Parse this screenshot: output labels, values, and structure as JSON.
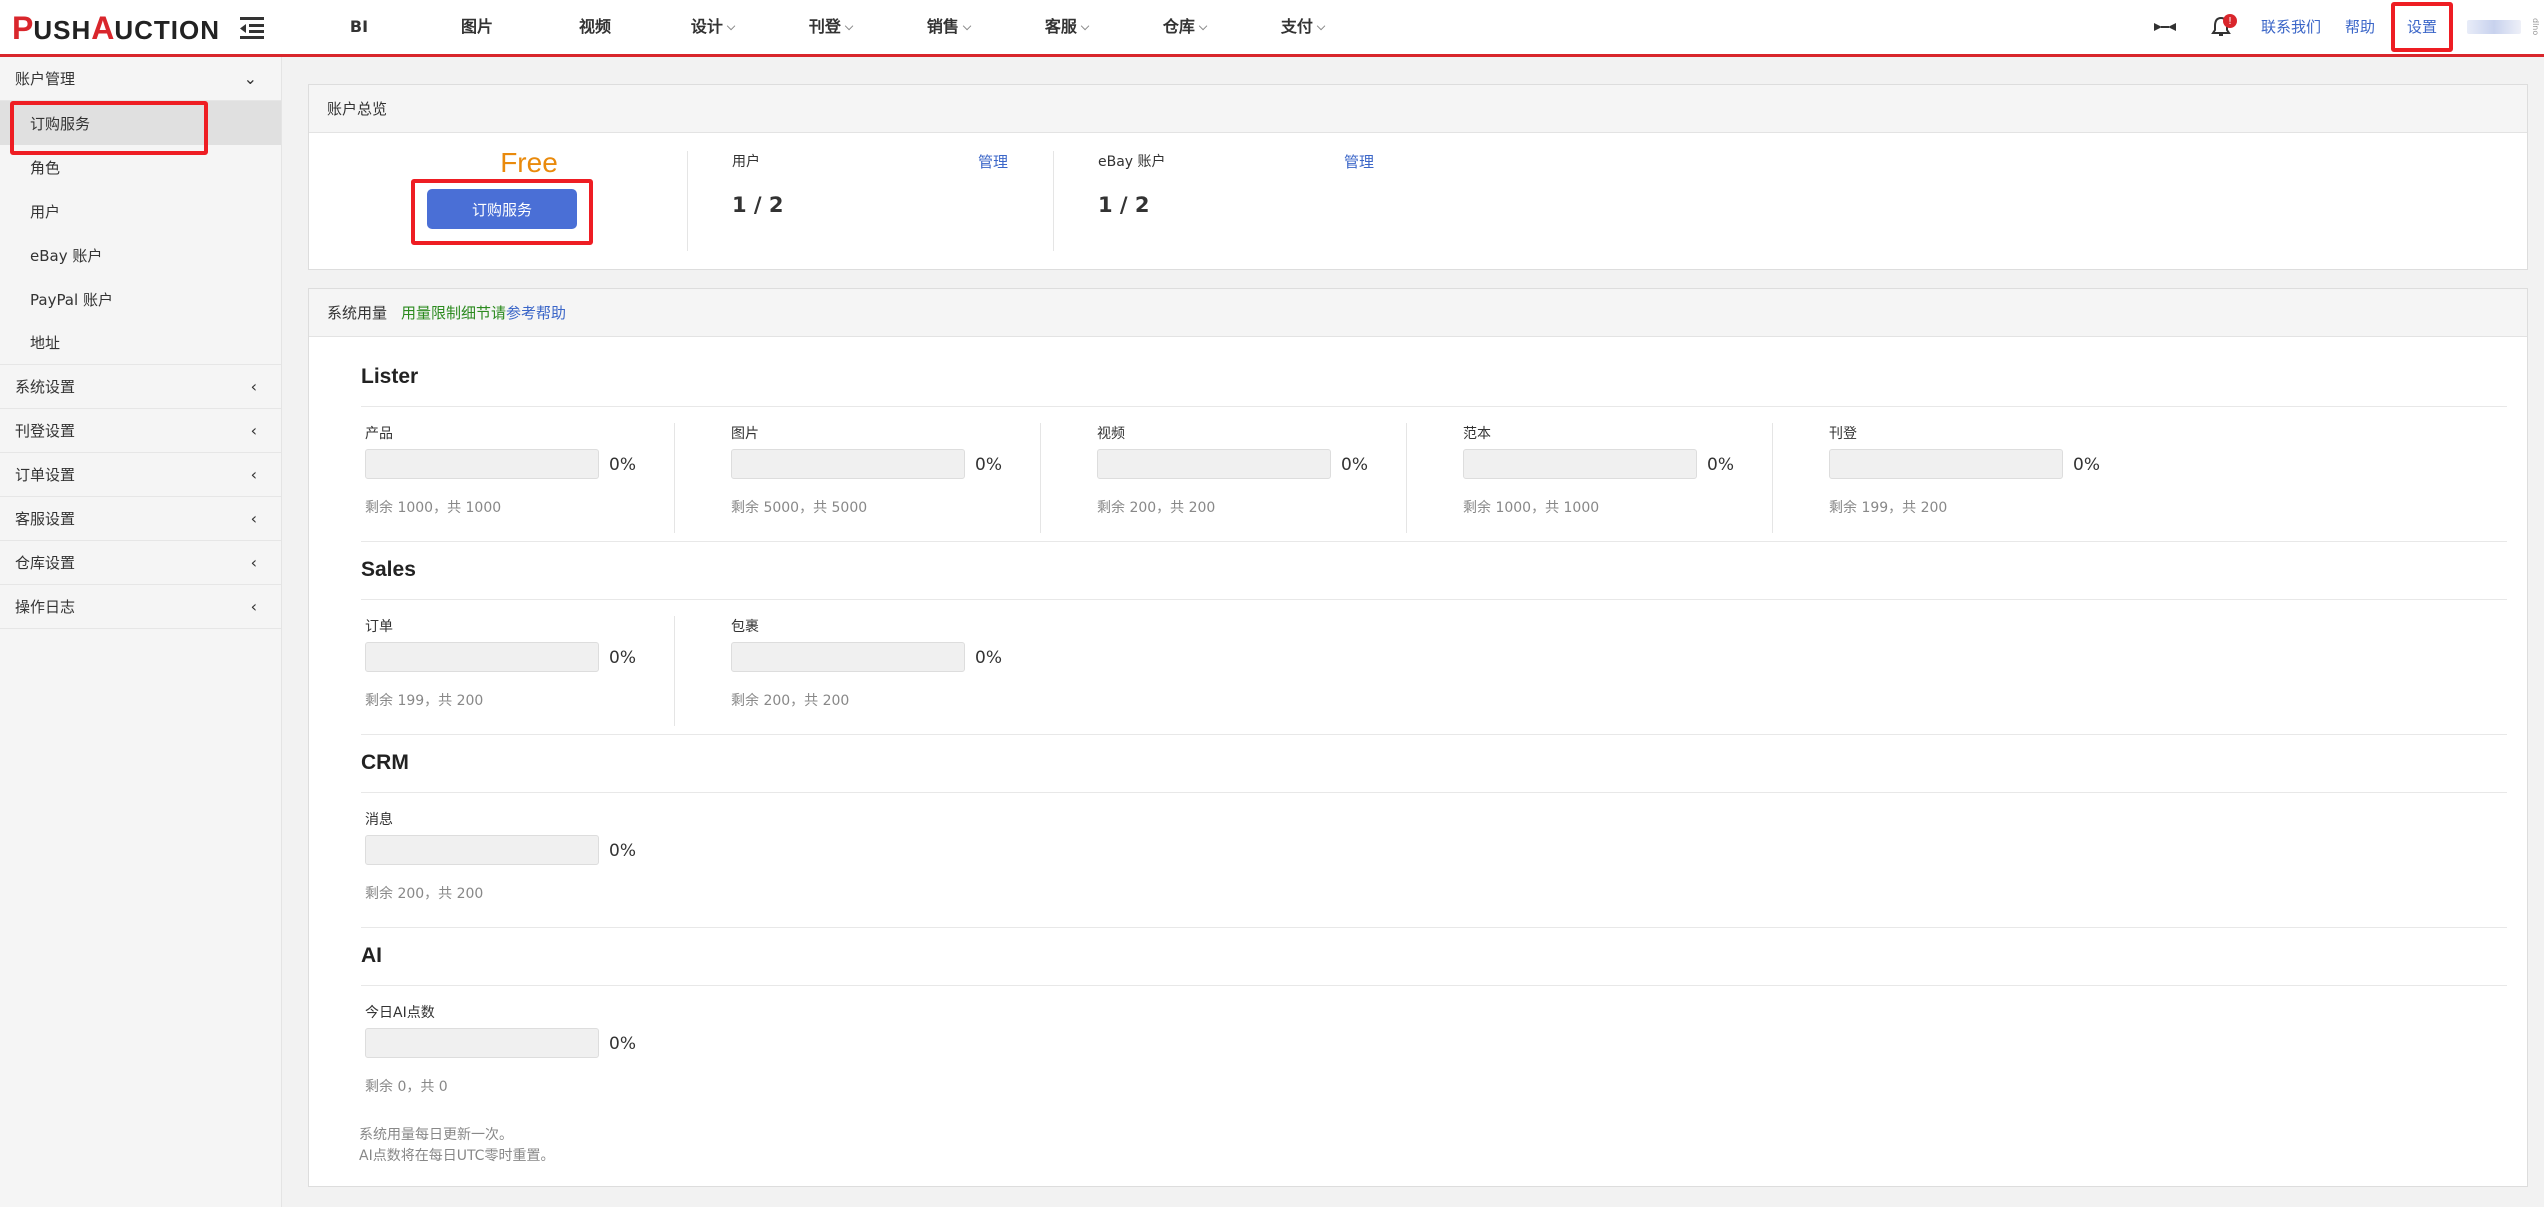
{
  "logo": {
    "p": "P",
    "ush": "USH",
    "a": "A",
    "uction": "UCTION"
  },
  "nav": [
    {
      "label": "BI",
      "chev": false
    },
    {
      "label": "图片",
      "chev": false
    },
    {
      "label": "视频",
      "chev": false
    },
    {
      "label": "设计",
      "chev": true
    },
    {
      "label": "刊登",
      "chev": true
    },
    {
      "label": "销售",
      "chev": true
    },
    {
      "label": "客服",
      "chev": true
    },
    {
      "label": "仓库",
      "chev": true
    },
    {
      "label": "支付",
      "chev": true
    }
  ],
  "right_nav": {
    "notification_count": "!",
    "contact": "联系我们",
    "help": "帮助",
    "settings": "设置",
    "corner": "dlno"
  },
  "sidebar": {
    "account_group": "账户管理",
    "items": [
      "订购服务",
      "角色",
      "用户",
      "eBay 账户",
      "PayPal 账户",
      "地址"
    ],
    "groups": [
      "系统设置",
      "刊登设置",
      "订单设置",
      "客服设置",
      "仓库设置",
      "操作日志"
    ]
  },
  "overview": {
    "title": "账户总览",
    "plan": "Free",
    "subscribe_btn": "订购服务",
    "users_label": "用户",
    "users_manage": "管理",
    "users_value": "1 / 2",
    "ebay_label": "eBay 账户",
    "ebay_manage": "管理",
    "ebay_value": "1 / 2"
  },
  "usage": {
    "title": "系统用量",
    "limit_detail": "用量限制细节请",
    "help_link": "参考帮助",
    "sections": [
      {
        "title": "Lister",
        "metrics": [
          {
            "label": "产品",
            "pct": "0%",
            "fill": 0,
            "remaining": "剩余 1000，共 1000"
          },
          {
            "label": "图片",
            "pct": "0%",
            "fill": 0,
            "remaining": "剩余 5000，共 5000"
          },
          {
            "label": "视频",
            "pct": "0%",
            "fill": 0,
            "remaining": "剩余 200，共 200"
          },
          {
            "label": "范本",
            "pct": "0%",
            "fill": 0,
            "remaining": "剩余 1000，共 1000"
          },
          {
            "label": "刊登",
            "pct": "0%",
            "fill": 0,
            "remaining": "剩余 199，共 200"
          }
        ]
      },
      {
        "title": "Sales",
        "metrics": [
          {
            "label": "订单",
            "pct": "0%",
            "fill": 0,
            "remaining": "剩余 199，共 200"
          },
          {
            "label": "包裹",
            "pct": "0%",
            "fill": 0,
            "remaining": "剩余 200，共 200"
          }
        ]
      },
      {
        "title": "CRM",
        "metrics": [
          {
            "label": "消息",
            "pct": "0%",
            "fill": 0,
            "remaining": "剩余 200，共 200"
          }
        ]
      },
      {
        "title": "AI",
        "metrics": [
          {
            "label": "今日AI点数",
            "pct": "0%",
            "fill": 0,
            "remaining": "剩余 0，共 0"
          }
        ]
      }
    ],
    "note1": "系统用量每日更新一次。",
    "note2": "AI点数将在每日UTC零时重置。"
  }
}
